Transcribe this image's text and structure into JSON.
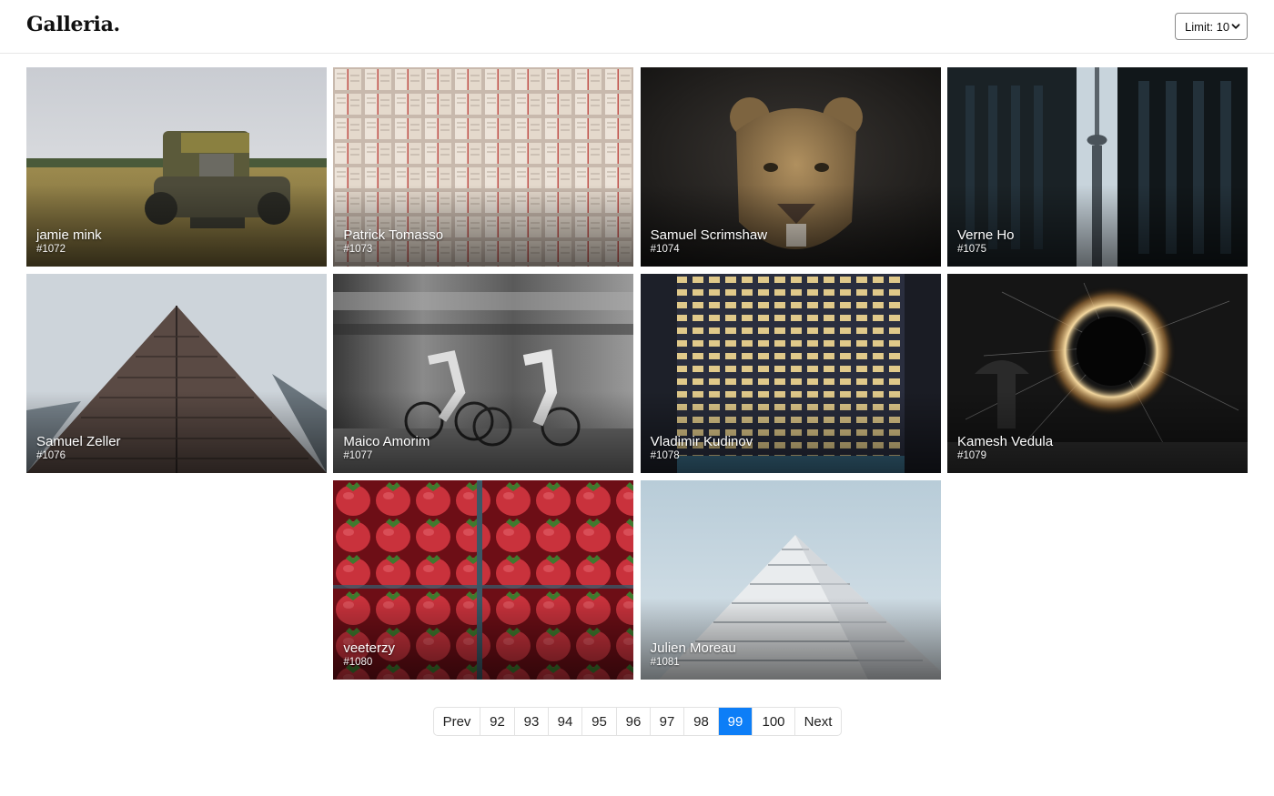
{
  "app": {
    "brand": "Galleria."
  },
  "header": {
    "limit_label": "Limit: 10",
    "limit_icon": "chevron-down-icon"
  },
  "gallery": {
    "photos": [
      {
        "author": "jamie mink",
        "id": "#1072"
      },
      {
        "author": "Patrick Tomasso",
        "id": "#1073"
      },
      {
        "author": "Samuel Scrimshaw",
        "id": "#1074"
      },
      {
        "author": "Verne Ho",
        "id": "#1075"
      },
      {
        "author": "Samuel Zeller",
        "id": "#1076"
      },
      {
        "author": "Maico Amorim",
        "id": "#1077"
      },
      {
        "author": "Vladimir Kudinov",
        "id": "#1078"
      },
      {
        "author": "Kamesh Vedula",
        "id": "#1079"
      },
      {
        "author": "veeterzy",
        "id": "#1080"
      },
      {
        "author": "Julien Moreau",
        "id": "#1081"
      }
    ]
  },
  "pagination": {
    "prev": "Prev",
    "next": "Next",
    "pages": [
      "92",
      "93",
      "94",
      "95",
      "96",
      "97",
      "98",
      "99",
      "100"
    ],
    "current": "99",
    "active_color": "#0d7ef7"
  }
}
